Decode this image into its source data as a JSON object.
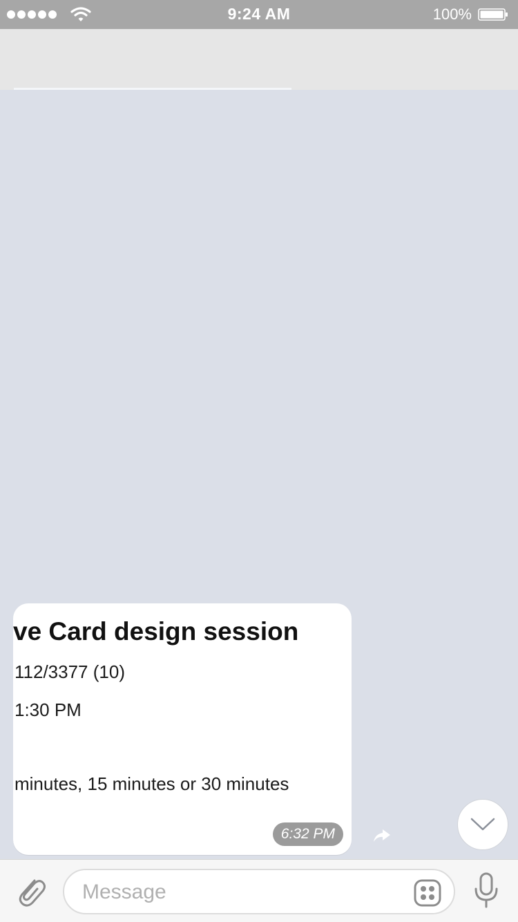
{
  "status_bar": {
    "time": "9:24 AM",
    "battery_percent": "100%",
    "battery_level": 1.0,
    "signal_bars": 5
  },
  "message": {
    "card_title": "ve Card design session",
    "room": "112/3377 (10)",
    "time": "1:30 PM",
    "options": "minutes, 15 minutes or 30 minutes",
    "timestamp": "6:32 PM"
  },
  "composer": {
    "placeholder": "Message"
  },
  "icons": {
    "signal": "signal-dots-icon",
    "wifi": "wifi-icon",
    "battery": "battery-icon",
    "forward": "forward-arrow-icon",
    "scroll_down": "chevron-down-icon",
    "attach": "paperclip-icon",
    "sticker": "sticker-icon",
    "mic": "microphone-icon"
  },
  "colors": {
    "status_bar": "#a7a7a7",
    "chat_background": "#dbdfe8",
    "timestamp_badge": "#9b9b9b"
  }
}
